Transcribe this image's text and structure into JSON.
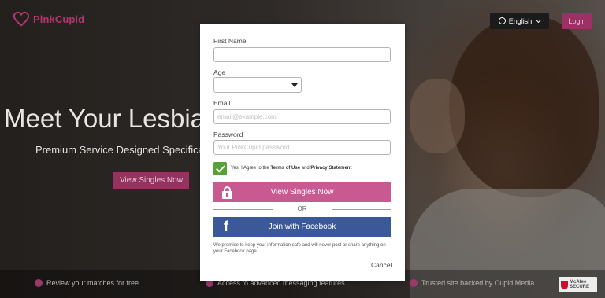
{
  "brand": {
    "name": "PinkCupid",
    "accent": "#b2376f"
  },
  "header": {
    "language": "English",
    "login_label": "Login"
  },
  "hero": {
    "title": "Meet Your Lesbia",
    "subtitle": "Premium Service Designed Specifical",
    "cta_label": "View Singles Now"
  },
  "features": [
    {
      "label": "Review your matches for free"
    },
    {
      "label": "Access to advanced messaging features"
    },
    {
      "label": "Trusted site backed by Cupid Media"
    }
  ],
  "badge": {
    "line1": "McAfee",
    "line2": "SECURE"
  },
  "form": {
    "first_name_label": "First Name",
    "first_name_value": "",
    "age_label": "Age",
    "age_value": "",
    "email_label": "Email",
    "email_placeholder": "email@example.com",
    "password_label": "Password",
    "password_placeholder": "Your PinkCupid password",
    "agree_prefix": "Yes, I Agree to the ",
    "terms_link": "Terms of Use",
    "agree_and": " and ",
    "privacy_link": "Privacy Statement",
    "agree_checked": true,
    "submit_label": "View Singles Now",
    "or_label": "OR",
    "facebook_label": "Join with Facebook",
    "promise_text": "We promise to keep your information safe and will never post or share anything on your Facebook page.",
    "cancel_label": "Cancel"
  },
  "icons": {
    "logo": "heart-icon",
    "language": "globe-icon",
    "dropdown": "chevron-down-icon",
    "submit": "lock-icon",
    "facebook": "facebook-icon",
    "checkbox": "check-icon"
  },
  "colors": {
    "primary_button": "#c95a91",
    "facebook": "#3b5998",
    "checkbox": "#58a136",
    "login": "#9b3164"
  }
}
